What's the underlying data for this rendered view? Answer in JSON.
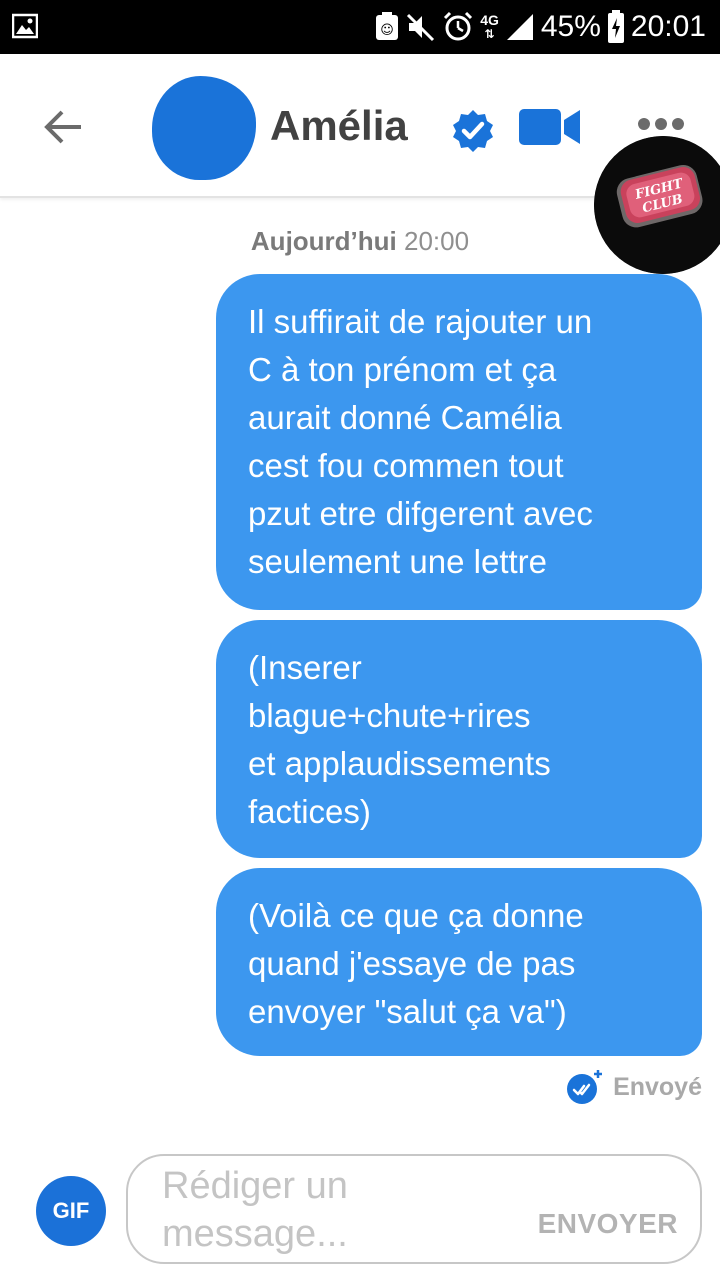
{
  "status_bar": {
    "signal_label": "4G",
    "battery_percent": "45%",
    "time": "20:01",
    "icons": [
      "image-icon",
      "nfc-icon",
      "mute-icon",
      "alarm-icon",
      "network-4g-icon",
      "signal-icon",
      "battery-charging-icon"
    ]
  },
  "header": {
    "contact_name": "Amélia",
    "icons": [
      "back-arrow-icon",
      "verified-badge-icon",
      "video-call-icon",
      "more-options-icon"
    ],
    "accent_color": "#1a73d9"
  },
  "sticker": {
    "text_line1": "FIGHT",
    "text_line2": "CLUB"
  },
  "chat": {
    "timestamp_day": "Aujourd’hui",
    "timestamp_time": "20:00",
    "bubble_color": "#3c97ef",
    "messages": [
      {
        "from": "me",
        "text": "Il suffirait de rajouter un\nC à ton prénom et ça\naurait donné Camélia\ncest fou commen tout\npzut etre difgerent avec\nseulement une lettre"
      },
      {
        "from": "me",
        "text": "(Inserer\nblague+chute+rires\net applaudissements\nfactices)"
      },
      {
        "from": "me",
        "text": "(Voilà ce que ça donne\nquand j'essaye de pas\nenvoyer \"salut ça va\")"
      }
    ],
    "sent_status": "Envoyé"
  },
  "composer": {
    "gif_label": "GIF",
    "placeholder": "Rédiger un message...",
    "value": "",
    "send_label": "ENVOYER"
  }
}
